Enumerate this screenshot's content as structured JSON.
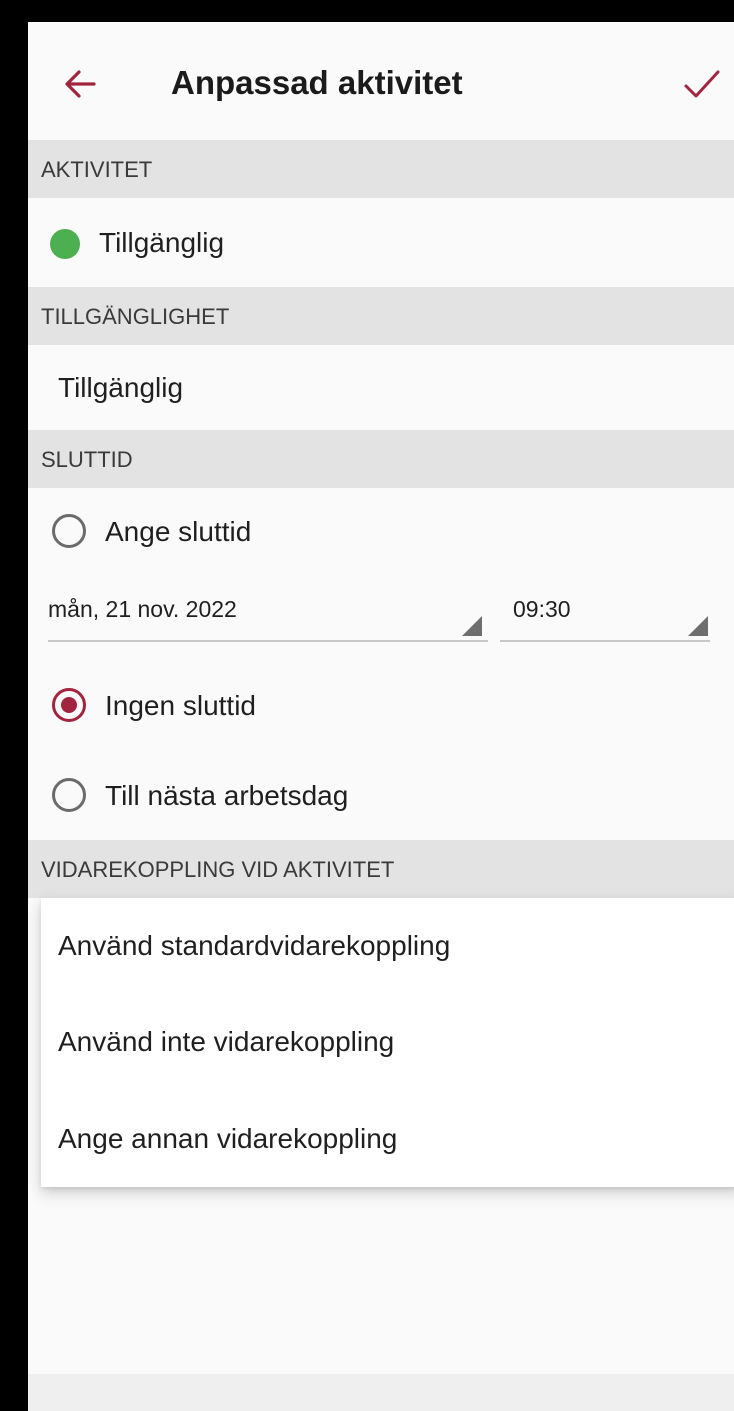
{
  "header": {
    "title": "Anpassad aktivitet",
    "back_icon": "arrow-back-icon",
    "save_icon": "checkmark-icon",
    "accent_color": "#a3243f"
  },
  "sections": {
    "activity": {
      "header": "AKTIVITET",
      "value": "Tillgänglig",
      "status_color": "#4caf50"
    },
    "availability": {
      "header": "TILLGÄNGLIGHET",
      "value": "Tillgänglig"
    },
    "end_time": {
      "header": "SLUTTID",
      "options": [
        {
          "label": "Ange sluttid",
          "checked": false
        },
        {
          "label": "Ingen sluttid",
          "checked": true
        },
        {
          "label": "Till nästa arbetsdag",
          "checked": false
        }
      ],
      "date": "mån, 21 nov. 2022",
      "time": "09:30"
    },
    "forwarding": {
      "header": "VIDAREKOPPLING VID AKTIVITET",
      "menu_items": [
        "Använd standardvidarekoppling",
        "Använd inte vidarekoppling",
        "Ange annan vidarekoppling"
      ]
    }
  }
}
